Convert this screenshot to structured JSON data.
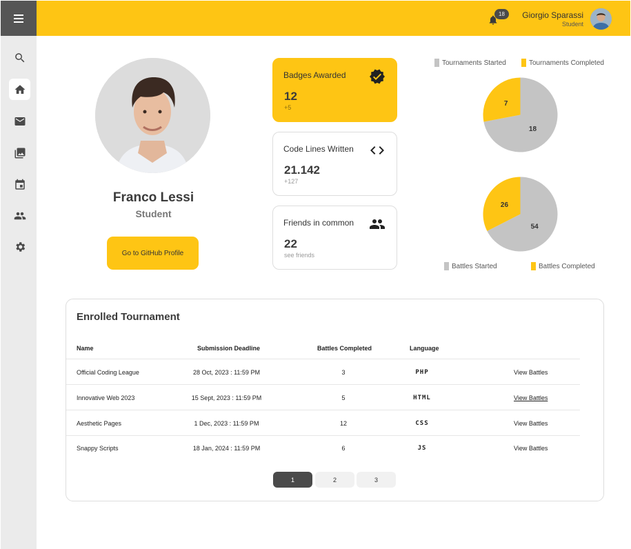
{
  "header": {
    "notification_count": "18",
    "user_name": "Giorgio Sparassi",
    "user_role": "Student"
  },
  "sidebar": {
    "items": [
      {
        "icon": "search-icon"
      },
      {
        "icon": "home-icon",
        "active": true
      },
      {
        "icon": "mail-icon"
      },
      {
        "icon": "gallery-icon"
      },
      {
        "icon": "calendar-icon"
      },
      {
        "icon": "people-icon"
      },
      {
        "icon": "gear-icon"
      }
    ]
  },
  "profile": {
    "name": "Franco Lessi",
    "role": "Student",
    "github_button": "Go to GitHub Profile"
  },
  "cards": {
    "badges": {
      "title": "Badges Awarded",
      "value": "12",
      "sub": "+5",
      "icon": "verified-badge-icon"
    },
    "code": {
      "title": "Code Lines Written",
      "value": "21.142",
      "sub": "+127",
      "icon": "code-icon"
    },
    "friends": {
      "title": "Friends in common",
      "value": "22",
      "sub": "see friends",
      "icon": "people-icon"
    }
  },
  "colors": {
    "accent": "#fec514",
    "gray": "#c4c4c4",
    "dark": "#4a4a4a"
  },
  "chart_data": [
    {
      "type": "pie",
      "legend": [
        "Tournaments Started",
        "Tournaments Completed"
      ],
      "legend_position": "top",
      "series": [
        {
          "name": "Tournaments Started",
          "value": 18,
          "color": "#c4c4c4"
        },
        {
          "name": "Tournaments Completed",
          "value": 7,
          "color": "#fec514"
        }
      ]
    },
    {
      "type": "pie",
      "legend": [
        "Battles Started",
        "Battles Completed"
      ],
      "legend_position": "bottom",
      "series": [
        {
          "name": "Battles Started",
          "value": 54,
          "color": "#c4c4c4"
        },
        {
          "name": "Battles Completed",
          "value": 26,
          "color": "#fec514"
        }
      ]
    }
  ],
  "table": {
    "title": "Enrolled Tournament",
    "columns": [
      "Name",
      "Submission Deadline",
      "Battles Completed",
      "Language"
    ],
    "rows": [
      {
        "name": "Official Coding League",
        "deadline": "28 Oct, 2023 : 11:59 PM",
        "battles": "3",
        "language": "PHP",
        "action": "View Battles"
      },
      {
        "name": "Innovative Web 2023",
        "deadline": "15 Sept, 2023 : 11:59 PM",
        "battles": "5",
        "language": "HTML",
        "action": "View Battles"
      },
      {
        "name": "Aesthetic Pages",
        "deadline": "1 Dec, 2023 : 11:59 PM",
        "battles": "12",
        "language": "CSS",
        "action": "View Battles"
      },
      {
        "name": "Snappy Scripts",
        "deadline": "18 Jan, 2024 : 11:59 PM",
        "battles": "6",
        "language": "JS",
        "action": "View Battles"
      }
    ],
    "pages": [
      "1",
      "2",
      "3"
    ],
    "current_page": "1"
  }
}
